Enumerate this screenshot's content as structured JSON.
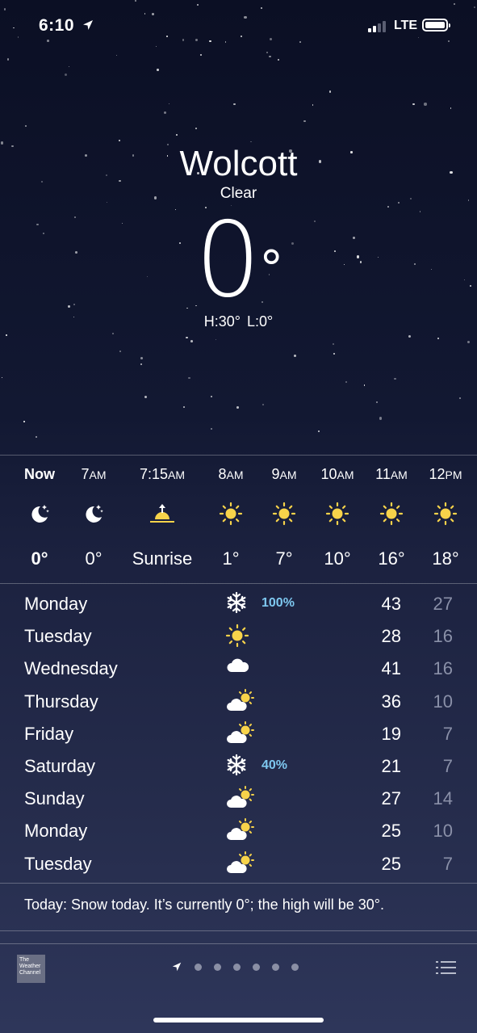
{
  "status_bar": {
    "time": "6:10",
    "network": "LTE"
  },
  "header": {
    "city": "Wolcott",
    "condition": "Clear",
    "temperature": "0",
    "degree_symbol": "°",
    "high": "H:30°",
    "low": "L:0°"
  },
  "hourly": [
    {
      "label": "Now",
      "ampm": "",
      "icon": "moon-stars-icon",
      "value": "0°"
    },
    {
      "label": "7",
      "ampm": "AM",
      "icon": "moon-stars-icon",
      "value": "0°"
    },
    {
      "label": "7:15",
      "ampm": "AM",
      "icon": "sunrise-icon",
      "value": "Sunrise"
    },
    {
      "label": "8",
      "ampm": "AM",
      "icon": "sun-icon",
      "value": "1°"
    },
    {
      "label": "9",
      "ampm": "AM",
      "icon": "sun-icon",
      "value": "7°"
    },
    {
      "label": "10",
      "ampm": "AM",
      "icon": "sun-icon",
      "value": "10°"
    },
    {
      "label": "11",
      "ampm": "AM",
      "icon": "sun-icon",
      "value": "16°"
    },
    {
      "label": "12",
      "ampm": "PM",
      "icon": "sun-icon",
      "value": "18°"
    }
  ],
  "daily": [
    {
      "day": "Monday",
      "icon": "snowflake-icon",
      "precip": "100%",
      "high": "43",
      "low": "27"
    },
    {
      "day": "Tuesday",
      "icon": "sun-icon",
      "precip": "",
      "high": "28",
      "low": "16"
    },
    {
      "day": "Wednesday",
      "icon": "cloud-icon",
      "precip": "",
      "high": "41",
      "low": "16"
    },
    {
      "day": "Thursday",
      "icon": "partly-cloudy-icon",
      "precip": "",
      "high": "36",
      "low": "10"
    },
    {
      "day": "Friday",
      "icon": "partly-cloudy-icon",
      "precip": "",
      "high": "19",
      "low": "7"
    },
    {
      "day": "Saturday",
      "icon": "snowflake-icon",
      "precip": "40%",
      "high": "21",
      "low": "7"
    },
    {
      "day": "Sunday",
      "icon": "partly-cloudy-icon",
      "precip": "",
      "high": "27",
      "low": "14"
    },
    {
      "day": "Monday",
      "icon": "partly-cloudy-icon",
      "precip": "",
      "high": "25",
      "low": "10"
    },
    {
      "day": "Tuesday",
      "icon": "partly-cloudy-icon",
      "precip": "",
      "high": "25",
      "low": "7"
    }
  ],
  "summary": "Today: Snow today. It’s currently 0°; the high will be 30°.",
  "toolbar": {
    "logo_text": "The Weather Channel",
    "page_count": 7,
    "active_page": 0
  },
  "colors": {
    "precip": "#7ec8f0",
    "sun": "#f7d34a",
    "low_temp": "#8a90a8"
  }
}
